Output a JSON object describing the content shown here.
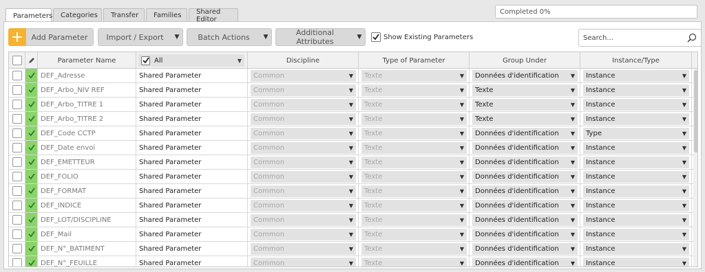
{
  "tabs": [
    {
      "label": "Parameters",
      "active": true
    },
    {
      "label": "Categories",
      "active": false
    },
    {
      "label": "Transfer",
      "active": false
    },
    {
      "label": "Families",
      "active": false
    },
    {
      "label": "Shared Editor",
      "active": false
    }
  ],
  "progress": {
    "text": "Completed 0%",
    "value": 0
  },
  "toolbar": {
    "add_label": "Add Parameter",
    "import_export_label": "Import / Export",
    "batch_actions_label": "Batch Actions",
    "additional_attributes_label": "Additional Attributes",
    "show_existing_label": "Show Existing Parameters",
    "show_existing_checked": true,
    "search_placeholder": "Search..."
  },
  "columns": {
    "name": "Parameter Name",
    "filter_value": "All",
    "discipline": "Discipline",
    "type": "Type of Parameter",
    "group": "Group Under",
    "instance": "Instance/Type"
  },
  "rows": [
    {
      "name": "DEF_Adresse",
      "param_type": "Shared Parameter",
      "discipline": "Common",
      "type": "Texte",
      "group": "Données d'identification",
      "instance": "Instance"
    },
    {
      "name": "DEF_Arbo_NIV REF",
      "param_type": "Shared Parameter",
      "discipline": "Common",
      "type": "Texte",
      "group": "Texte",
      "instance": "Instance"
    },
    {
      "name": "DEF_Arbo_TITRE 1",
      "param_type": "Shared Parameter",
      "discipline": "Common",
      "type": "Texte",
      "group": "Texte",
      "instance": "Instance"
    },
    {
      "name": "DEF_Arbo_TITRE 2",
      "param_type": "Shared Parameter",
      "discipline": "Common",
      "type": "Texte",
      "group": "Texte",
      "instance": "Instance"
    },
    {
      "name": "DEF_Code CCTP",
      "param_type": "Shared Parameter",
      "discipline": "Common",
      "type": "Texte",
      "group": "Données d'identification",
      "instance": "Type"
    },
    {
      "name": "DEF_Date envoi",
      "param_type": "Shared Parameter",
      "discipline": "Common",
      "type": "Texte",
      "group": "Données d'identification",
      "instance": "Instance"
    },
    {
      "name": "DEF_EMETTEUR",
      "param_type": "Shared Parameter",
      "discipline": "Common",
      "type": "Texte",
      "group": "Données d'identification",
      "instance": "Instance"
    },
    {
      "name": "DEF_FOLIO",
      "param_type": "Shared Parameter",
      "discipline": "Common",
      "type": "Texte",
      "group": "Données d'identification",
      "instance": "Instance"
    },
    {
      "name": "DEF_FORMAT",
      "param_type": "Shared Parameter",
      "discipline": "Common",
      "type": "Texte",
      "group": "Données d'identification",
      "instance": "Instance"
    },
    {
      "name": "DEF_INDICE",
      "param_type": "Shared Parameter",
      "discipline": "Common",
      "type": "Texte",
      "group": "Données d'identification",
      "instance": "Instance"
    },
    {
      "name": "DEF_LOT/DISCIPLINE",
      "param_type": "Shared Parameter",
      "discipline": "Common",
      "type": "Texte",
      "group": "Données d'identification",
      "instance": "Instance"
    },
    {
      "name": "DEF_Mail",
      "param_type": "Shared Parameter",
      "discipline": "Common",
      "type": "Texte",
      "group": "Données d'identification",
      "instance": "Instance"
    },
    {
      "name": "DEF_N°_BATIMENT",
      "param_type": "Shared Parameter",
      "discipline": "Common",
      "type": "Texte",
      "group": "Données d'identification",
      "instance": "Instance"
    },
    {
      "name": "DEF_N°_FEUILLE",
      "param_type": "Shared Parameter",
      "discipline": "Common",
      "type": "Texte",
      "group": "Données d'identification",
      "instance": "Instance"
    }
  ],
  "colors": {
    "accent": "#f5b233",
    "status_ok": "#8bd36b",
    "check_green": "#2f7a2a"
  },
  "icons": {
    "add": "plus-icon",
    "search": "magnifier-icon",
    "edit": "pencil-icon",
    "status": "checkmark-icon"
  }
}
